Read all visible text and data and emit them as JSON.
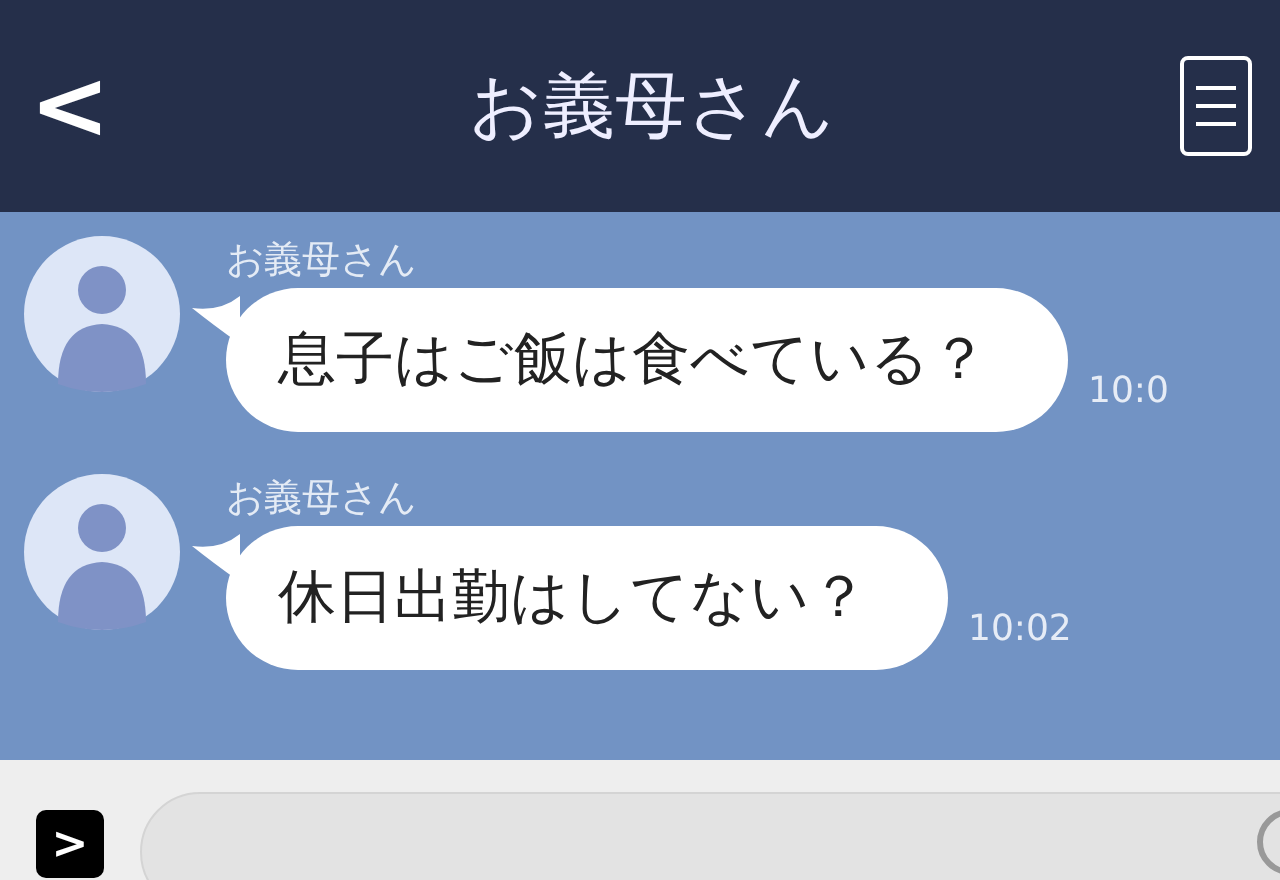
{
  "header": {
    "back": "<",
    "title": "お義母さん"
  },
  "messages": [
    {
      "sender": "お義母さん",
      "text": "息子はご飯は食べている？",
      "time": "10:0"
    },
    {
      "sender": "お義母さん",
      "text": "休日出勤はしてない？",
      "time": "10:02"
    }
  ],
  "input": {
    "expand": ">"
  }
}
